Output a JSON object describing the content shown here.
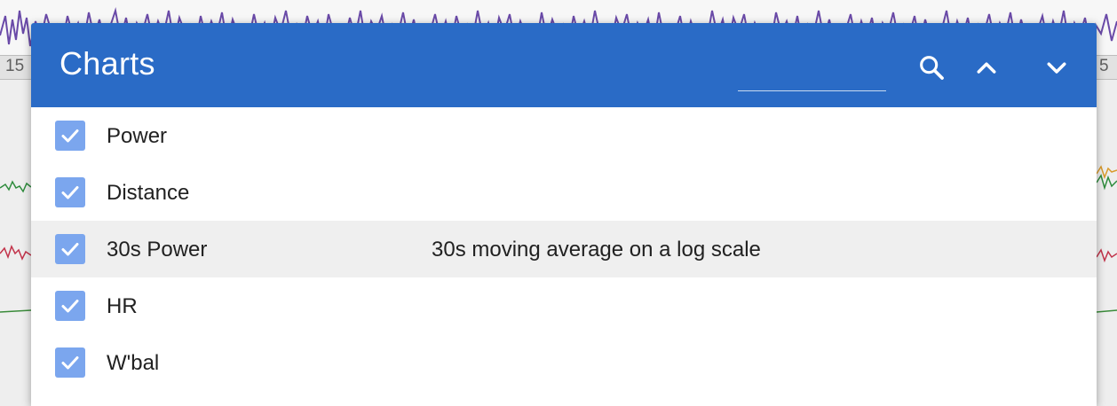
{
  "background": {
    "axis_tick_left": "15",
    "axis_tick_right": "5"
  },
  "dialog": {
    "title": "Charts",
    "search": {
      "value": "",
      "placeholder": ""
    },
    "icons": {
      "search": "search-icon",
      "up": "chevron-up-icon",
      "down": "chevron-down-icon"
    },
    "items": [
      {
        "label": "Power",
        "checked": true,
        "description": ""
      },
      {
        "label": "Distance",
        "checked": true,
        "description": ""
      },
      {
        "label": "30s Power",
        "checked": true,
        "description": "30s moving average on a log scale",
        "highlighted": true
      },
      {
        "label": "HR",
        "checked": true,
        "description": ""
      },
      {
        "label": "W'bal",
        "checked": true,
        "description": ""
      }
    ]
  },
  "colors": {
    "header": "#2a6bc6",
    "checkbox": "#7ba6ee",
    "highlight_row": "#efefef",
    "power_line": "#6a4aa8"
  }
}
